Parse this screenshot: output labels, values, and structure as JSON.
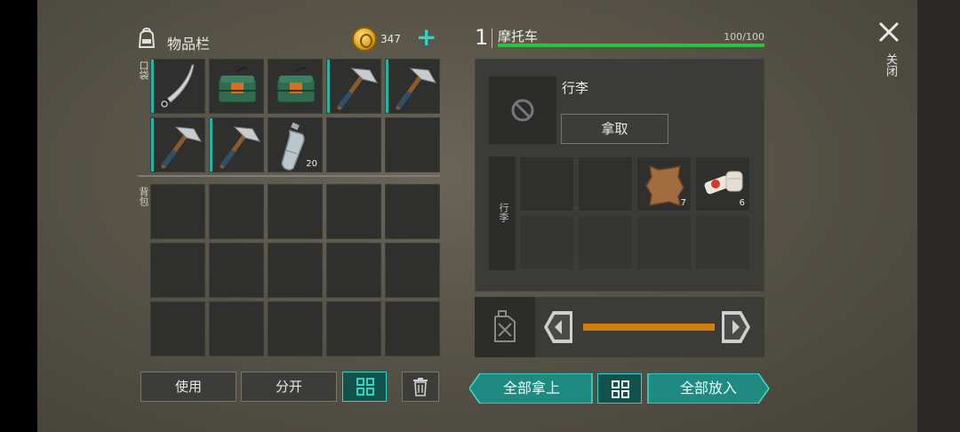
{
  "inventory": {
    "title": "物品栏",
    "coins": "347",
    "pocket_label": "口袋",
    "backpack_label": "背包",
    "pocket_items": [
      {
        "icon": "machete-icon",
        "qty": ""
      },
      {
        "icon": "dynamite-icon",
        "qty": ""
      },
      {
        "icon": "dynamite-icon",
        "qty": ""
      },
      {
        "icon": "pickaxe-icon",
        "qty": ""
      },
      {
        "icon": "pickaxe-icon",
        "qty": ""
      },
      {
        "icon": "pickaxe-icon",
        "qty": ""
      },
      {
        "icon": "pickaxe-icon",
        "qty": ""
      },
      {
        "icon": "water-bottle-icon",
        "qty": "20"
      },
      {
        "icon": "",
        "qty": ""
      },
      {
        "icon": "",
        "qty": ""
      }
    ],
    "buttons": {
      "use": "使用",
      "split": "分开"
    }
  },
  "vehicle": {
    "number": "1",
    "name": "摩托车",
    "hp_text": "100/100",
    "hp_fraction": 1.0,
    "luggage_title": "行李",
    "take_label": "拿取",
    "strip_label": "行李",
    "items": [
      {
        "icon": "",
        "qty": ""
      },
      {
        "icon": "",
        "qty": ""
      },
      {
        "icon": "leather-hide-icon",
        "qty": "7"
      },
      {
        "icon": "bandage-icon",
        "qty": "6"
      }
    ],
    "fuel_fraction": 1.0
  },
  "actions": {
    "take_all": "全部拿上",
    "put_all": "全部放入"
  },
  "close_label": "关闭",
  "colors": {
    "accent": "#2fd4c4",
    "hp": "#27c53a",
    "fuel": "#d0800c"
  }
}
